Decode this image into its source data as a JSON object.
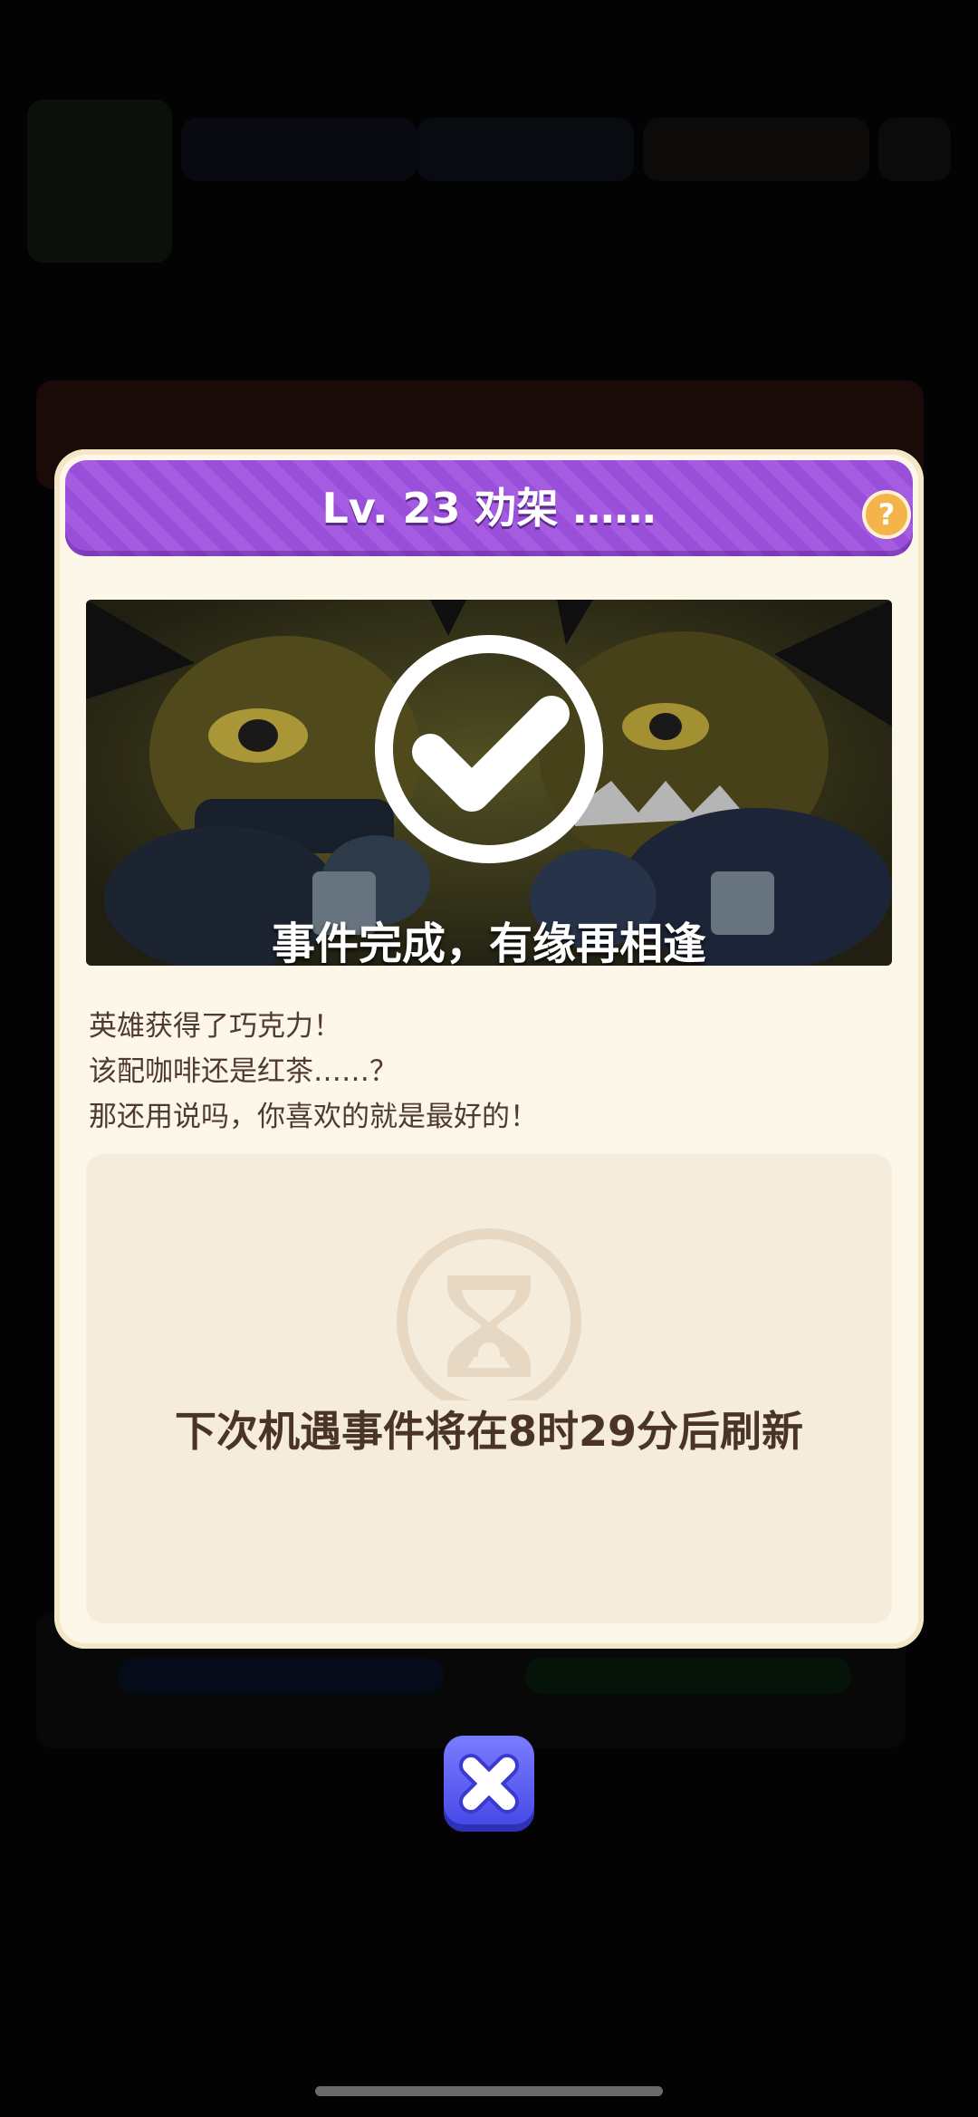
{
  "modal": {
    "title": "Lv. 23 劝架 ……",
    "help_icon": "question-icon",
    "banner_caption": "事件完成，有缘再相逢",
    "banner_icon": "checkmark-circle-icon",
    "description": [
      "英雄获得了巧克力！",
      "该配咖啡还是红茶……？",
      "那还用说吗，你喜欢的就是最好的！"
    ],
    "timer_icon": "hourglass-icon",
    "timer_text": "下次机遇事件将在8时29分后刷新",
    "close_icon": "close-icon"
  },
  "colors": {
    "header": "#9a4fdb",
    "modal_bg": "#fdf7e9",
    "close_button": "#4446e6",
    "help_button": "#f4b44a"
  }
}
